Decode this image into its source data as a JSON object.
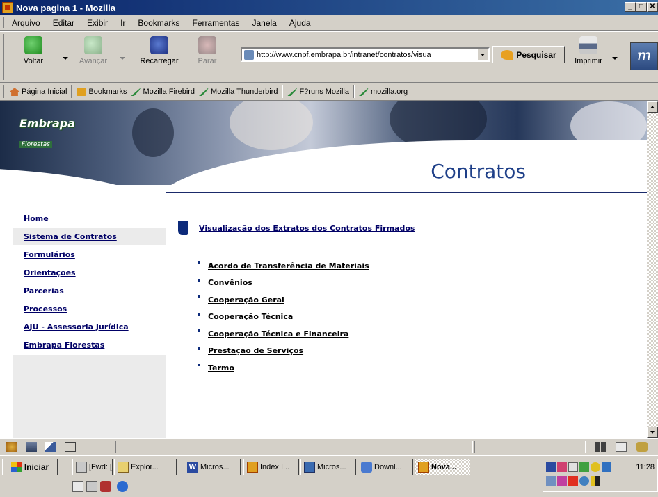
{
  "window": {
    "title": "Nova pagina 1 - Mozilla",
    "min_label": "_",
    "max_label": "□",
    "close_label": "✕"
  },
  "menu": [
    "Arquivo",
    "Editar",
    "Exibir",
    "Ir",
    "Bookmarks",
    "Ferramentas",
    "Janela",
    "Ajuda"
  ],
  "nav": {
    "back": "Voltar",
    "forward": "Avançar",
    "reload": "Recarregar",
    "stop": "Parar",
    "url": "http://www.cnpf.embrapa.br/intranet/contratos/visua",
    "search": "Pesquisar",
    "print": "Imprimir",
    "brand_logo": "m"
  },
  "personal_toolbar": [
    "Página Inicial",
    "Bookmarks",
    "Mozilla Firebird",
    "Mozilla Thunderbird",
    "F?runs Mozilla",
    "mozilla.org"
  ],
  "banner": {
    "logo_main": "Embrapa",
    "logo_sub": "Florestas",
    "page_title": "Contratos"
  },
  "sidebar": [
    "Home",
    "Sistema de Contratos",
    "Formulários",
    "Orientações",
    "Parcerias",
    "Processos",
    "AJU - Assessoria Jurídica",
    "Embrapa Florestas"
  ],
  "main": {
    "heading_link": "Visualização dos Extratos dos Contratos Firmados",
    "links": [
      "Acordo de Transferência de Materiais",
      "Convênios",
      "Cooperação Geral",
      "Cooperação Técnica",
      "Cooperação Técnica e Financeira",
      "Prestação de Serviços",
      "Termo"
    ]
  },
  "taskbar": {
    "start": "Iniciar",
    "buttons": [
      "[Fwd: [...",
      "Explor...",
      "Micros...",
      "Index I...",
      "Micros...",
      "Downl...",
      "Nova..."
    ],
    "clock": "11:28"
  },
  "colors": {
    "link": "#000066",
    "title_blue": "#1e3f88",
    "titlebar_start": "#0a246a",
    "titlebar_end": "#3a6ea5"
  }
}
